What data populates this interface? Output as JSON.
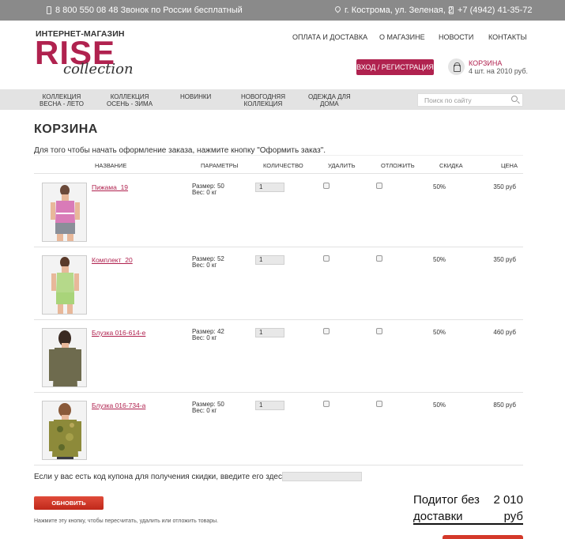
{
  "topbar": {
    "phone": "8 800 550 08 48 Звонок по России бесплатный",
    "address": "г. Кострома, ул. Зеленая, 2",
    "local_phone": "+7 (4942) 41-35-72"
  },
  "logo": {
    "tagline": "ИНТЕРНЕТ-МАГАЗИН",
    "brand": "RISE",
    "sub": "collection"
  },
  "nav": [
    "ОПЛАТА И ДОСТАВКА",
    "О МАГАЗИНЕ",
    "НОВОСТИ",
    "КОНТАКТЫ"
  ],
  "login_label": "ВХОД / РЕГИСТРАЦИЯ",
  "cart": {
    "title": "КОРЗИНА",
    "summary": "4 шт. на 2010 руб."
  },
  "categories": [
    [
      "КОЛЛЕКЦИЯ",
      "ВЕСНА - ЛЕТО"
    ],
    [
      "КОЛЛЕКЦИЯ",
      "ОСЕНЬ - ЗИМА"
    ],
    [
      "НОВИНКИ"
    ],
    [
      "НОВОГОДНЯЯ",
      "КОЛЛЕКЦИЯ"
    ],
    [
      "ОДЕЖДА ДЛЯ",
      "ДОМА"
    ]
  ],
  "search_placeholder": "Поиск по сайту",
  "page_title": "КОРЗИНА",
  "intro": "Для того чтобы начать оформление заказа, нажмите кнопку \"Оформить заказ\".",
  "columns": {
    "name": "НАЗВАНИЕ",
    "params": "ПАРАМЕТРЫ",
    "qty": "КОЛИЧЕСТВО",
    "delete": "УДАЛИТЬ",
    "postpone": "ОТЛОЖИТЬ",
    "discount": "СКИДКА",
    "price": "ЦЕНА"
  },
  "items": [
    {
      "name": "Пижама_19",
      "size": "Размер: 50",
      "weight": "Вес: 0 кг",
      "qty": "1",
      "discount": "50%",
      "price": "350 руб",
      "garment": "pajama-pink"
    },
    {
      "name": "Комплект_20",
      "size": "Размер: 52",
      "weight": "Вес: 0 кг",
      "qty": "1",
      "discount": "50%",
      "price": "350 руб",
      "garment": "set-green"
    },
    {
      "name": "Блузка 016-614-е",
      "size": "Размер: 42",
      "weight": "Вес: 0 кг",
      "qty": "1",
      "discount": "50%",
      "price": "460 руб",
      "garment": "blouse-olive"
    },
    {
      "name": "Блузка 016-734-а",
      "size": "Размер: 50",
      "weight": "Вес: 0 кг",
      "qty": "1",
      "discount": "50%",
      "price": "850 руб",
      "garment": "blouse-camo"
    }
  ],
  "coupon_label": "Если у вас есть код купона для получения скидки, введите его здесь:",
  "refresh_label": "ОБНОВИТЬ",
  "refresh_note": "Нажмите эту кнопку, чтобы пересчитать, удалить или отложить товары.",
  "subtotal": {
    "label1": "Подитог без",
    "value1": "2 010",
    "label2": "доставки",
    "value2": "руб"
  },
  "colors": {
    "brand": "#b0224f",
    "topbar": "#8a8a8a",
    "button_red": "#c0281a"
  }
}
